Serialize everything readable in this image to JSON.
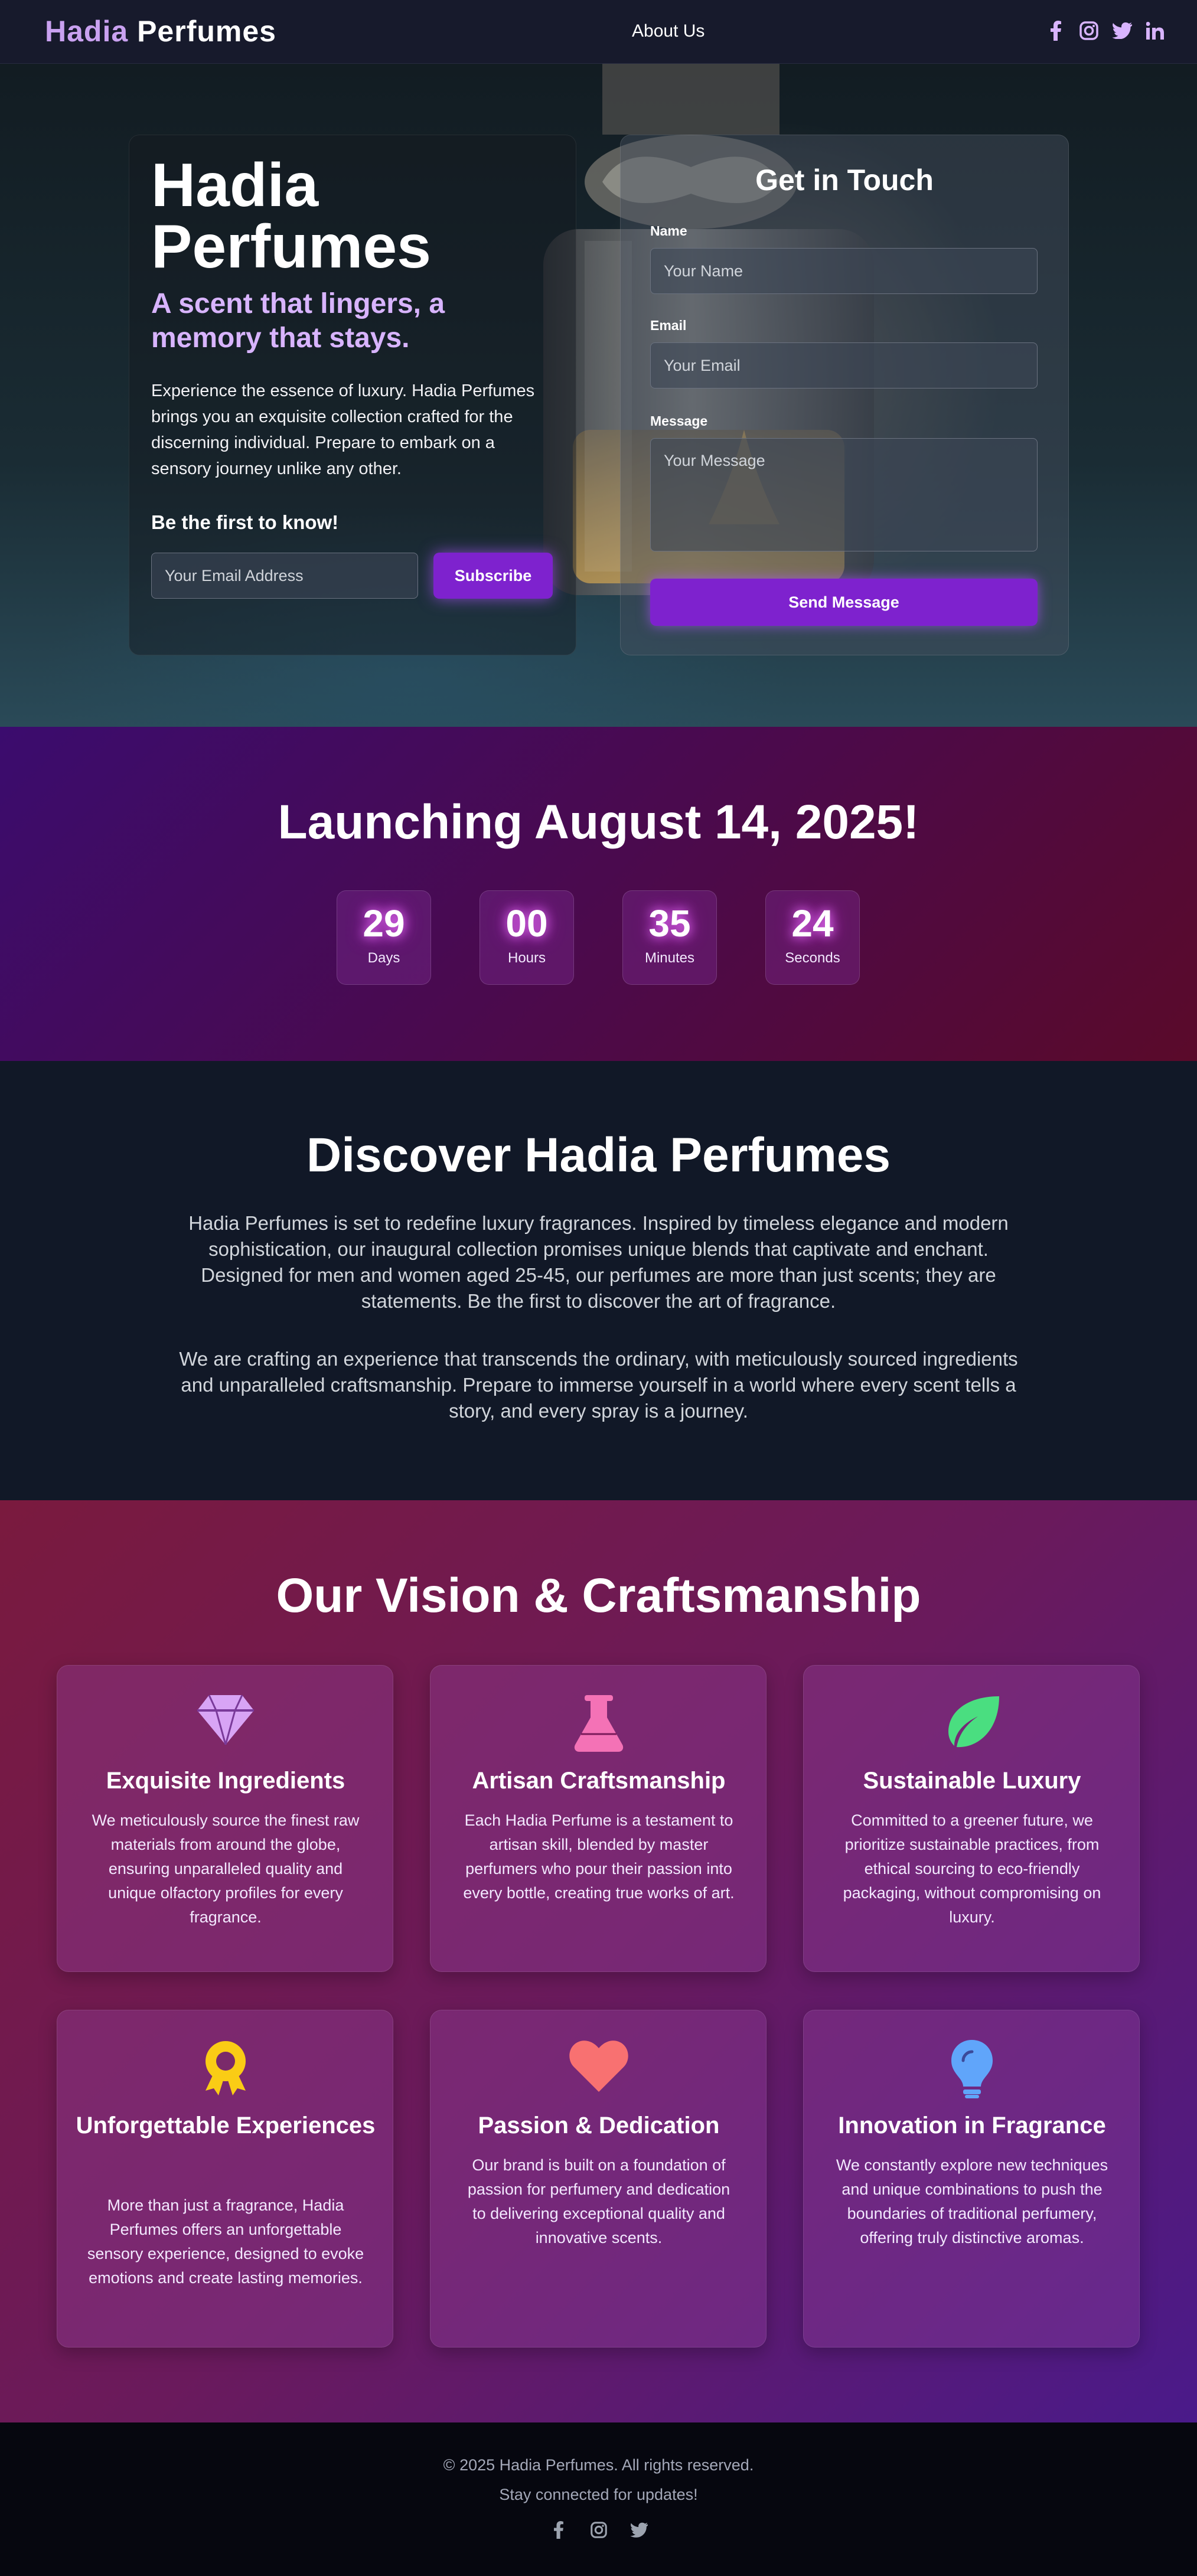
{
  "nav": {
    "logo_first": "Hadia",
    "logo_second": "Perfumes",
    "about_link": "About Us",
    "social_icons": [
      "facebook-icon",
      "instagram-icon",
      "twitter-icon",
      "linkedin-icon"
    ]
  },
  "hero": {
    "title": "Hadia Perfumes",
    "tagline": "A scent that lingers, a memory that stays.",
    "description": "Experience the essence of luxury. Hadia Perfumes brings you an exquisite collection crafted for the discerning individual. Prepare to embark on a sensory journey unlike any other.",
    "first_to_know": "Be the first to know!",
    "email_placeholder": "Your Email Address",
    "subscribe_label": "Subscribe"
  },
  "contact": {
    "title": "Get in Touch",
    "name_label": "Name",
    "name_placeholder": "Your Name",
    "email_label": "Email",
    "email_placeholder": "Your Email",
    "message_label": "Message",
    "message_placeholder": "Your Message",
    "send_label": "Send Message"
  },
  "countdown": {
    "title": "Launching August 14, 2025!",
    "units": [
      {
        "value": "29",
        "label": "Days"
      },
      {
        "value": "00",
        "label": "Hours"
      },
      {
        "value": "35",
        "label": "Minutes"
      },
      {
        "value": "24",
        "label": "Seconds"
      }
    ]
  },
  "discover": {
    "title": "Discover Hadia Perfumes",
    "paragraph1": "Hadia Perfumes is set to redefine luxury fragrances. Inspired by timeless elegance and modern sophistication, our inaugural collection promises unique blends that captivate and enchant. Designed for men and women aged 25-45, our perfumes are more than just scents; they are statements. Be the first to discover the art of fragrance.",
    "paragraph2": "We are crafting an experience that transcends the ordinary, with meticulously sourced ingredients and unparalleled craftsmanship. Prepare to immerse yourself in a world where every scent tells a story, and every spray is a journey."
  },
  "vision": {
    "title": "Our Vision & Craftsmanship",
    "cards": [
      {
        "icon": "gem-icon",
        "color": "#d8a4f5",
        "title": "Exquisite Ingredients",
        "text": "We meticulously source the finest raw materials from around the globe, ensuring unparalleled quality and unique olfactory profiles for every fragrance."
      },
      {
        "icon": "flask-icon",
        "color": "#f472b6",
        "title": "Artisan Craftsmanship",
        "text": "Each Hadia Perfume is a testament to artisan skill, blended by master perfumers who pour their passion into every bottle, creating true works of art."
      },
      {
        "icon": "leaf-icon",
        "color": "#4ade80",
        "title": "Sustainable Luxury",
        "text": "Committed to a greener future, we prioritize sustainable practices, from ethical sourcing to eco-friendly packaging, without compromising on luxury."
      },
      {
        "icon": "award-icon",
        "color": "#facc15",
        "title": "Unforgettable Experiences",
        "text": "More than just a fragrance, Hadia Perfumes offers an unforgettable sensory experience, designed to evoke emotions and create lasting memories."
      },
      {
        "icon": "heart-icon",
        "color": "#f87171",
        "title": "Passion & Dedication",
        "text": "Our brand is built on a foundation of passion for perfumery and dedication to delivering exceptional quality and innovative scents."
      },
      {
        "icon": "lightbulb-icon",
        "color": "#60a5fa",
        "title": "Innovation in Fragrance",
        "text": "We constantly explore new techniques and unique combinations to push the boundaries of traditional perfumery, offering truly distinctive aromas."
      }
    ]
  },
  "footer": {
    "copyright": "© 2025 Hadia Perfumes. All rights reserved.",
    "stay_connected": "Stay connected for updates!",
    "social_icons": [
      "facebook-icon",
      "instagram-icon",
      "twitter-icon"
    ]
  },
  "colors": {
    "accent": "#7e22ce",
    "logo_accent": "#c9a1f0",
    "tagline": "#d8b4fe"
  }
}
